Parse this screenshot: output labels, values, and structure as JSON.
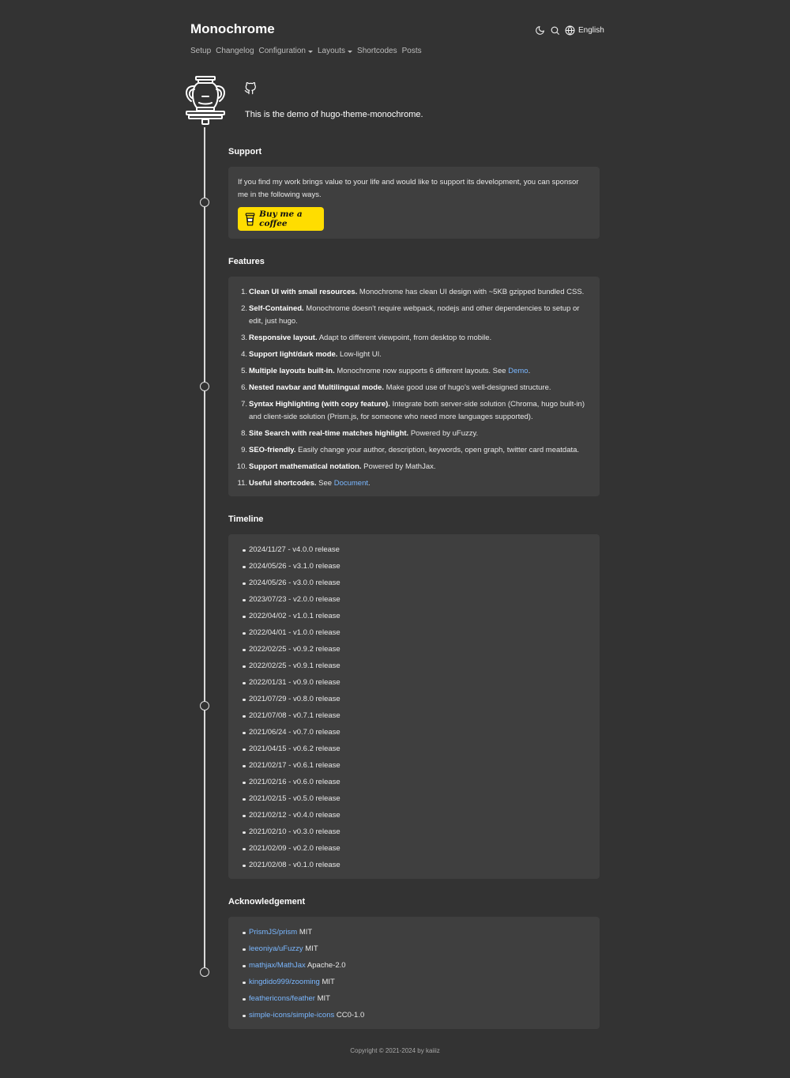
{
  "header": {
    "site_title": "Monochrome",
    "language": "English",
    "icons": [
      "moon-icon",
      "search-icon",
      "globe-icon"
    ]
  },
  "nav": {
    "items": [
      {
        "label": "Setup"
      },
      {
        "label": "Changelog"
      },
      {
        "label": "Configuration",
        "has_dropdown": true
      },
      {
        "label": "Layouts",
        "has_dropdown": true
      },
      {
        "label": "Shortcodes"
      },
      {
        "label": "Posts"
      }
    ]
  },
  "intro": {
    "text": "This is the demo of hugo-theme-monochrome."
  },
  "sections": {
    "support": {
      "title": "Support",
      "text": "If you find my work brings value to your life and would like to support its development, you can sponsor me in the following ways.",
      "button_label": "Buy me a coffee"
    },
    "features": {
      "title": "Features",
      "items": [
        {
          "num": "1.",
          "bold": "Clean UI with small resources.",
          "text": " Monochrome has clean UI design with ~5KB gzipped bundled CSS."
        },
        {
          "num": "2.",
          "bold": "Self-Contained.",
          "text": " Monochrome doesn't require webpack, nodejs and other dependencies to setup or edit, just hugo."
        },
        {
          "num": "3.",
          "bold": "Responsive layout.",
          "text": " Adapt to different viewpoint, from desktop to mobile."
        },
        {
          "num": "4.",
          "bold": "Support light/dark mode.",
          "text": " Low-light UI."
        },
        {
          "num": "5.",
          "bold": "Multiple layouts built-in.",
          "text": " Monochrome now supports 6 different layouts. See ",
          "link": "Demo",
          "after": "."
        },
        {
          "num": "6.",
          "bold": "Nested navbar and Multilingual mode.",
          "text": " Make good use of hugo's well-designed structure."
        },
        {
          "num": "7.",
          "bold": "Syntax Highlighting (with copy feature).",
          "text": " Integrate both server-side solution (Chroma, hugo built-in) and client-side solution (Prism.js, for someone who need more languages supported)."
        },
        {
          "num": "8.",
          "bold": "Site Search with real-time matches highlight.",
          "text": " Powered by uFuzzy."
        },
        {
          "num": "9.",
          "bold": "SEO-friendly.",
          "text": " Easily change your author, description, keywords, open graph, twitter card meatdata."
        },
        {
          "num": "10.",
          "bold": "Support mathematical notation.",
          "text": " Powered by MathJax."
        },
        {
          "num": "11.",
          "bold": "Useful shortcodes.",
          "text": " See ",
          "link": "Document",
          "after": "."
        }
      ]
    },
    "timeline": {
      "title": "Timeline",
      "items": [
        "2024/11/27 - v4.0.0 release",
        "2024/05/26 - v3.1.0 release",
        "2024/05/26 - v3.0.0 release",
        "2023/07/23 - v2.0.0 release",
        "2022/04/02 - v1.0.1 release",
        "2022/04/01 - v1.0.0 release",
        "2022/02/25 - v0.9.2 release",
        "2022/02/25 - v0.9.1 release",
        "2022/01/31 - v0.9.0 release",
        "2021/07/29 - v0.8.0 release",
        "2021/07/08 - v0.7.1 release",
        "2021/06/24 - v0.7.0 release",
        "2021/04/15 - v0.6.2 release",
        "2021/02/17 - v0.6.1 release",
        "2021/02/16 - v0.6.0 release",
        "2021/02/15 - v0.5.0 release",
        "2021/02/12 - v0.4.0 release",
        "2021/02/10 - v0.3.0 release",
        "2021/02/09 - v0.2.0 release",
        "2021/02/08 - v0.1.0 release"
      ]
    },
    "acknowledgement": {
      "title": "Acknowledgement",
      "items": [
        {
          "link": "PrismJS/prism",
          "license": "MIT"
        },
        {
          "link": "leeoniya/uFuzzy",
          "license": "MIT"
        },
        {
          "link": "mathjax/MathJax",
          "license": "Apache-2.0"
        },
        {
          "link": "kingdido999/zooming",
          "license": "MIT"
        },
        {
          "link": "feathericons/feather",
          "license": "MIT"
        },
        {
          "link": "simple-icons/simple-icons",
          "license": "CC0-1.0"
        }
      ]
    }
  },
  "footer": {
    "text": "Copyright © 2021-2024 by kaiiiz"
  },
  "colors": {
    "background": "#333333",
    "card": "#3f3f3f",
    "link": "#7ab7ff",
    "coffee_button": "#ffdd00"
  }
}
